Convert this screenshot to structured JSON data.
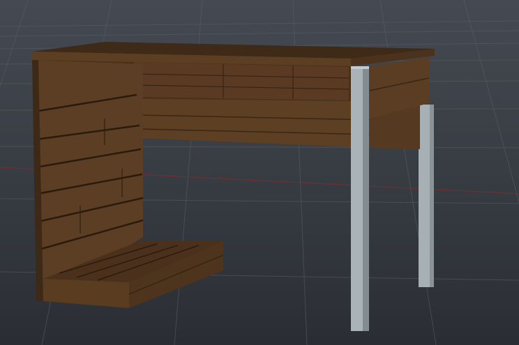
{
  "viewport": {
    "background_top": "#3e434a",
    "background_bottom": "#2a2e34",
    "grid_color": "#5a6068",
    "x_axis_color": "#8a2f2f"
  },
  "model": {
    "object": "desk",
    "wood_light": "#6a4a2c",
    "wood_mid": "#573b22",
    "wood_dark": "#3e2916",
    "wood_line": "#2a1c10",
    "leg_color": "#aab3b8",
    "leg_shadow": "#7f888d"
  }
}
